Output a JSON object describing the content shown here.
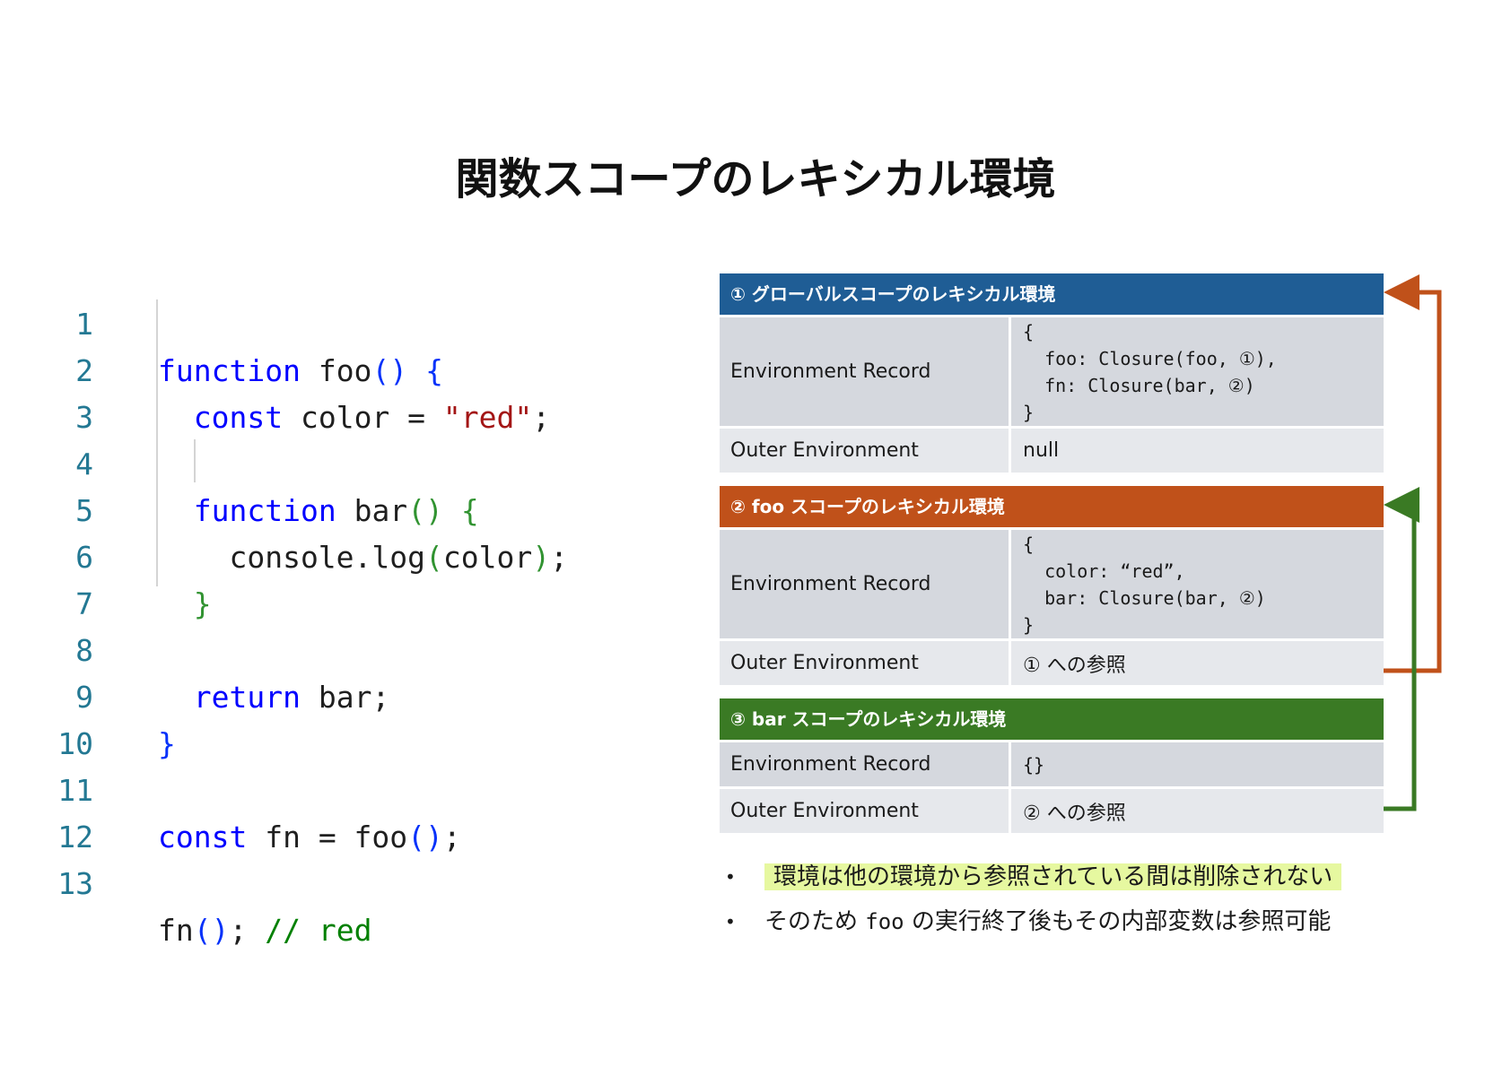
{
  "title": "関数スコープのレキシカル環境",
  "code": {
    "line_numbers": [
      "1",
      "2",
      "3",
      "4",
      "5",
      "6",
      "7",
      "8",
      "9",
      "10",
      "11",
      "12",
      "13"
    ]
  },
  "env": {
    "colors": {
      "global": "#1f5d95",
      "foo": "#c0511a",
      "bar": "#3a7a24"
    },
    "global": {
      "header": "① グローバルスコープのレキシカル環境",
      "record_label": "Environment Record",
      "record_lines": [
        "{",
        "  foo: Closure(foo, ①),",
        "  fn: Closure(bar, ②)",
        "}"
      ],
      "outer_label": "Outer Environment",
      "outer_value": "null"
    },
    "foo": {
      "header": "② foo スコープのレキシカル環境",
      "record_label": "Environment Record",
      "record_lines": [
        "{",
        "  color: “red”,",
        "  bar: Closure(bar, ②)",
        "}"
      ],
      "outer_label": "Outer Environment",
      "outer_value": "① への参照"
    },
    "bar": {
      "header": "③ bar スコープのレキシカル環境",
      "record_label": "Environment Record",
      "record_value": "{}",
      "outer_label": "Outer Environment",
      "outer_value": "② への参照"
    }
  },
  "notes": {
    "note1": "環境は他の環境から参照されている間は削除されない",
    "note2_before": "そのため ",
    "note2_code": "foo",
    "note2_after": " の実行終了後もその内部変数は参照可能",
    "bullet": "•"
  }
}
